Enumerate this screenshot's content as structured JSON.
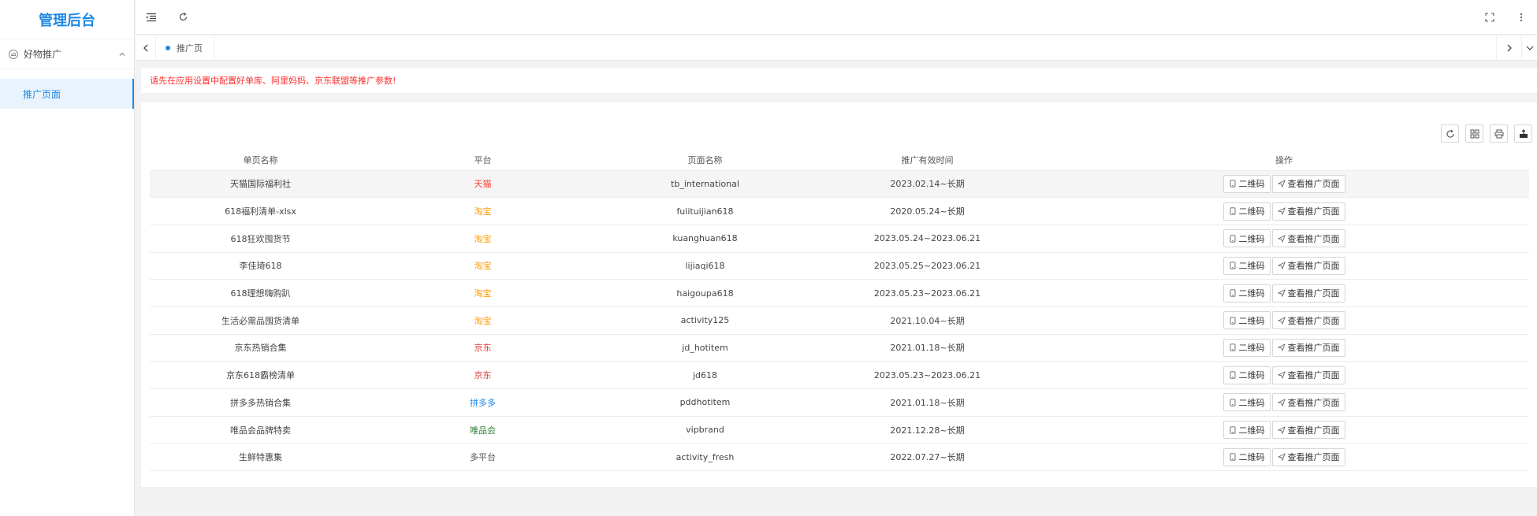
{
  "app": {
    "title": "管理后台"
  },
  "sidebar": {
    "group": {
      "label": "好物推广",
      "icon": "cloud-icon"
    },
    "items": [
      {
        "label": "推广页面"
      }
    ]
  },
  "tabs": [
    {
      "label": "推广页"
    }
  ],
  "notice": "请先在应用设置中配置好单库、阿里妈妈、京东联盟等推广参数!",
  "table": {
    "columns": [
      "单页名称",
      "平台",
      "页面名称",
      "推广有效时间",
      "操作"
    ],
    "actions": {
      "qrcode": "二维码",
      "view": "查看推广页面"
    },
    "rows": [
      {
        "name": "天猫国际福利社",
        "platform": "天猫",
        "color": "#ff3b30",
        "page": "tb_international",
        "time": "2023.02.14~长期"
      },
      {
        "name": "618福利清单-xlsx",
        "platform": "淘宝",
        "color": "#ff9800",
        "page": "fulituijian618",
        "time": "2020.05.24~长期"
      },
      {
        "name": "618狂欢囤货节",
        "platform": "淘宝",
        "color": "#ff9800",
        "page": "kuanghuan618",
        "time": "2023.05.24~2023.06.21"
      },
      {
        "name": "李佳琦618",
        "platform": "淘宝",
        "color": "#ff9800",
        "page": "lijiaqi618",
        "time": "2023.05.25~2023.06.21"
      },
      {
        "name": "618理想嗨购趴",
        "platform": "淘宝",
        "color": "#ff9800",
        "page": "haigoupa618",
        "time": "2023.05.23~2023.06.21"
      },
      {
        "name": "生活必需品囤货清单",
        "platform": "淘宝",
        "color": "#ff9800",
        "page": "activity125",
        "time": "2021.10.04~长期"
      },
      {
        "name": "京东热销合集",
        "platform": "京东",
        "color": "#e53935",
        "page": "jd_hotitem",
        "time": "2021.01.18~长期"
      },
      {
        "name": "京东618霸榜清单",
        "platform": "京东",
        "color": "#e53935",
        "page": "jd618",
        "time": "2023.05.23~2023.06.21"
      },
      {
        "name": "拼多多热销合集",
        "platform": "拼多多",
        "color": "#1e88e5",
        "page": "pddhotitem",
        "time": "2021.01.18~长期"
      },
      {
        "name": "唯品会品牌特卖",
        "platform": "唯品会",
        "color": "#2e7d32",
        "page": "vipbrand",
        "time": "2021.12.28~长期"
      },
      {
        "name": "生鲜特惠集",
        "platform": "多平台",
        "color": "#555555",
        "page": "activity_fresh",
        "time": "2022.07.27~长期"
      }
    ]
  }
}
